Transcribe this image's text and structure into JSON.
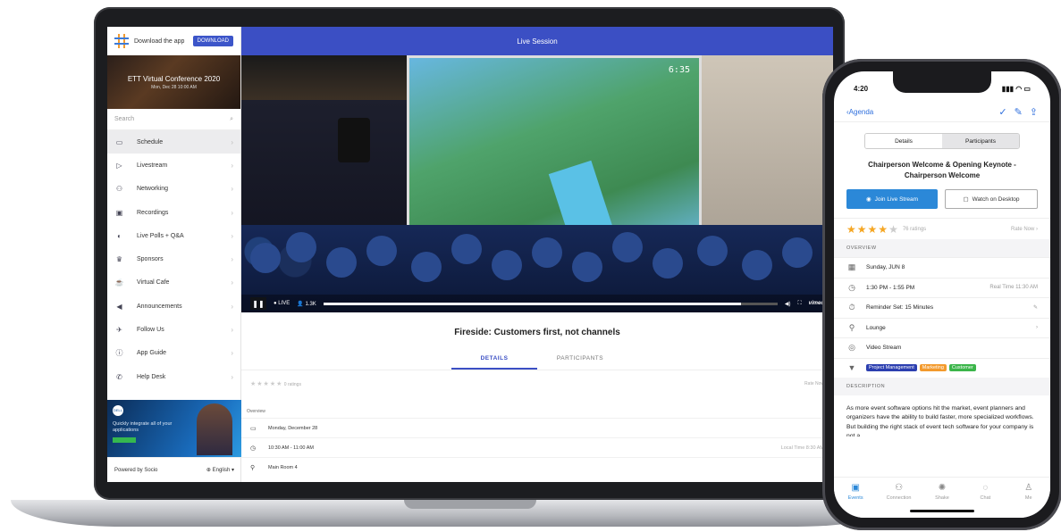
{
  "laptop": {
    "sidebar": {
      "download_text": "Download the app",
      "download_button": "DOWNLOAD",
      "event_title": "ETT Virtual Conference 2020",
      "event_date": "Mon, Dec 28 10:00 AM",
      "search_placeholder": "Search",
      "items": [
        {
          "label": "Schedule",
          "icon": "calendar-icon",
          "glyph": "▭"
        },
        {
          "label": "Livestream",
          "icon": "livestream-icon",
          "glyph": "▷"
        },
        {
          "label": "Networking",
          "icon": "networking-icon",
          "glyph": "⚇"
        },
        {
          "label": "Recordings",
          "icon": "recordings-icon",
          "glyph": "▣"
        },
        {
          "label": "Live Polls + Q&A",
          "icon": "polls-icon",
          "glyph": "◐"
        },
        {
          "label": "Sponsors",
          "icon": "trophy-icon",
          "glyph": "♛"
        },
        {
          "label": "Virtual Cafe",
          "icon": "cafe-icon",
          "glyph": "☕"
        },
        {
          "label": "Announcements",
          "icon": "megaphone-icon",
          "glyph": "◀"
        },
        {
          "label": "Follow Us",
          "icon": "twitter-icon",
          "glyph": "✈"
        },
        {
          "label": "App Guide",
          "icon": "info-icon",
          "glyph": "ⓘ"
        },
        {
          "label": "Help Desk",
          "icon": "help-icon",
          "glyph": "✆"
        }
      ],
      "ad_text": "Quickly integrate all of your applications",
      "powered_by": "Powered by Socio",
      "language": "English"
    },
    "main": {
      "header": "Live Session",
      "video": {
        "hud_time": "6:35",
        "live_label": "LIVE",
        "viewers": "1.3K",
        "provider": "vimeo",
        "progress": 0.92
      },
      "session_title": "Fireside: Customers first, not channels",
      "tabs": [
        "DETAILS",
        "PARTICIPANTS"
      ],
      "rating_count": "0 ratings",
      "rate_label": "Rate Now",
      "overview_label": "Overview",
      "date": "Monday, December 28",
      "time": "10:30 AM - 11:00 AM",
      "local_time": "Local Time 8:30 AM",
      "location": "Main Room 4"
    }
  },
  "phone": {
    "status_time": "4:20",
    "back_label": "Agenda",
    "segments": [
      "Details",
      "Participants"
    ],
    "title": "Chairperson Welcome & Opening Keynote - Chairperson Welcome",
    "join_button": "Join Live Stream",
    "watch_button": "Watch on Desktop",
    "rating": 4,
    "rating_max": 5,
    "rating_count": "76 ratings",
    "rate_label": "Rate Now",
    "overview_label": "OVERVIEW",
    "date": "Sunday, JUN 8",
    "time": "1:30 PM - 1:55 PM",
    "local_time": "Real Time 11:30 AM",
    "reminder": "Reminder Set: 15 Minutes",
    "location": "Lounge",
    "stream": "Video Stream",
    "tags": [
      {
        "label": "Project Management",
        "color": "#2c3fb0"
      },
      {
        "label": "Marketing",
        "color": "#f39a2d"
      },
      {
        "label": "Customer",
        "color": "#3bb54a"
      }
    ],
    "description_label": "DESCRIPTION",
    "description": "As more event software options hit the market, event planners and organizers have the ability to build faster, more specialized workflows. But building the right stack of event tech software for your company is not a",
    "tabbar": [
      "Events",
      "Connection",
      "Shake",
      "Chat",
      "Me"
    ]
  },
  "colors": {
    "primary": "#3b4fc4",
    "phone_accent": "#2b88d8",
    "star": "#f5a623"
  }
}
